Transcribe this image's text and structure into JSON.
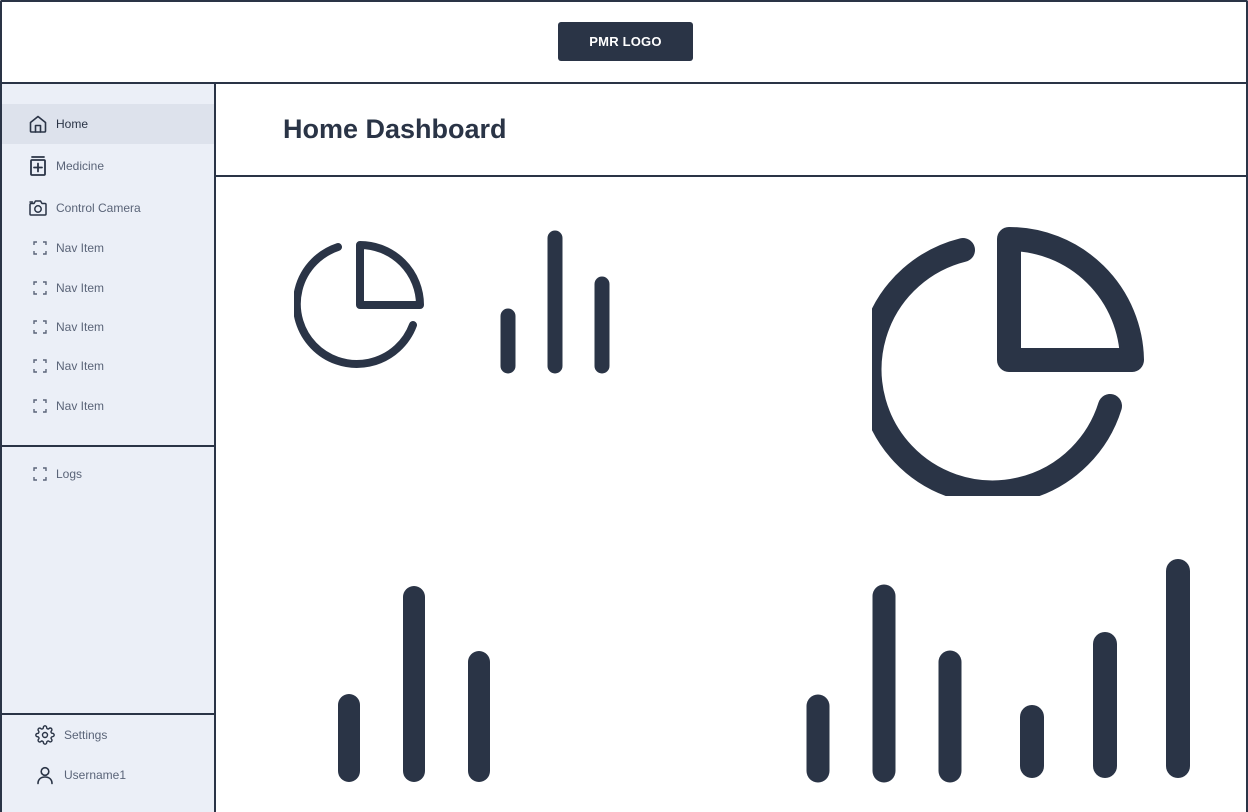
{
  "header": {
    "logo_text": "PMR LOGO"
  },
  "sidebar": {
    "items": [
      {
        "label": "Home",
        "icon": "home-icon",
        "active": true
      },
      {
        "label": "Medicine",
        "icon": "medicine-icon",
        "active": false
      },
      {
        "label": "Control Camera",
        "icon": "camera-icon",
        "active": false
      },
      {
        "label": "Nav Item",
        "icon": "placeholder-icon",
        "active": false
      },
      {
        "label": "Nav Item",
        "icon": "placeholder-icon",
        "active": false
      },
      {
        "label": "Nav Item",
        "icon": "placeholder-icon",
        "active": false
      },
      {
        "label": "Nav Item",
        "icon": "placeholder-icon",
        "active": false
      },
      {
        "label": "Nav Item",
        "icon": "placeholder-icon",
        "active": false
      }
    ],
    "secondary_items": [
      {
        "label": "Logs",
        "icon": "placeholder-icon"
      }
    ],
    "footer_items": [
      {
        "label": "Settings",
        "icon": "gear-icon"
      },
      {
        "label": "Username1",
        "icon": "user-icon"
      }
    ]
  },
  "main": {
    "title": "Home Dashboard",
    "widgets": [
      {
        "type": "pie-chart-icon"
      },
      {
        "type": "bar-chart-icon"
      },
      {
        "type": "pie-chart-icon"
      },
      {
        "type": "bar-chart-icon"
      },
      {
        "type": "bar-chart-icon"
      }
    ]
  },
  "colors": {
    "primary": "#2a3446",
    "sidebar_bg": "#ebeff7",
    "active_bg": "#dde2ec",
    "muted_text": "#5a6478"
  }
}
